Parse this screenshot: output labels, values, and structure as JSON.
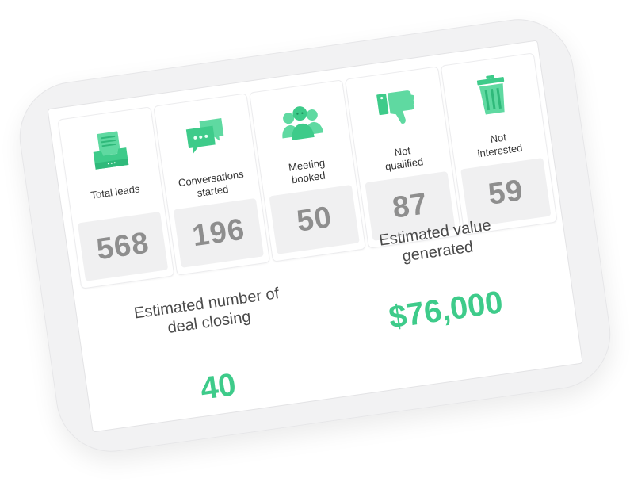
{
  "accent_color": "#3ecb8a",
  "value_color": "#8e8e8e",
  "stats": [
    {
      "label_line1": "Total leads",
      "label_line2": "",
      "value": "568",
      "icon": "inbox-tray-icon"
    },
    {
      "label_line1": "Conversations",
      "label_line2": "started",
      "value": "196",
      "icon": "chat-bubbles-icon"
    },
    {
      "label_line1": "Meeting",
      "label_line2": "booked",
      "value": "50",
      "icon": "people-group-icon"
    },
    {
      "label_line1": "Not",
      "label_line2": "qualified",
      "value": "87",
      "icon": "thumbs-down-icon"
    },
    {
      "label_line1": "Not",
      "label_line2": "interested",
      "value": "59",
      "icon": "trash-can-icon"
    }
  ],
  "summary": {
    "deals_label_line1": "Estimated number of",
    "deals_label_line2": "deal closing",
    "deals_value": "40",
    "value_label_line1": "Estimated value",
    "value_label_line2": "generated",
    "value_amount": "$76,000"
  }
}
